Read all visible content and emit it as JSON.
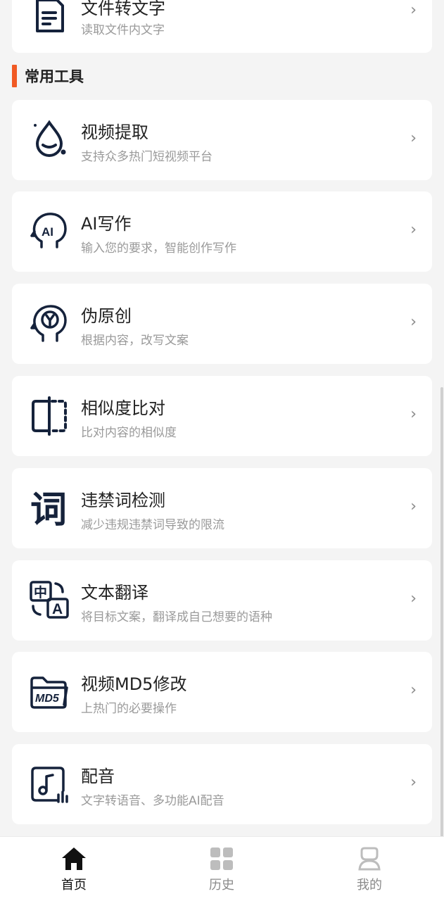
{
  "top_card": {
    "title": "文件转文字",
    "subtitle": "读取文件内文字"
  },
  "section": {
    "title": "常用工具"
  },
  "tools": [
    {
      "title": "视频提取",
      "subtitle": "支持众多热门短视频平台",
      "icon": "video-extract-drop-icon"
    },
    {
      "title": "AI写作",
      "subtitle": "输入您的要求，智能创作写作",
      "icon": "ai-head-icon"
    },
    {
      "title": "伪原创",
      "subtitle": "根据内容，改写文案",
      "icon": "brain-head-icon"
    },
    {
      "title": "相似度比对",
      "subtitle": "比对内容的相似度",
      "icon": "compare-icon"
    },
    {
      "title": "违禁词检测",
      "subtitle": "减少违规违禁词导致的限流",
      "icon": "word-check-icon"
    },
    {
      "title": "文本翻译",
      "subtitle": "将目标文案，翻译成自己想要的语种",
      "icon": "translate-icon"
    },
    {
      "title": "视频MD5修改",
      "subtitle": "上热门的必要操作",
      "icon": "md5-folder-icon"
    },
    {
      "title": "配音",
      "subtitle": "文字转语音、多功能AI配音",
      "icon": "dubbing-icon"
    }
  ],
  "chevron": "›",
  "tabbar": {
    "tabs": [
      {
        "label": "首页",
        "icon": "home-icon",
        "active": true
      },
      {
        "label": "历史",
        "icon": "grid-icon",
        "active": false
      },
      {
        "label": "我的",
        "icon": "user-icon",
        "active": false
      }
    ]
  },
  "colors": {
    "accent": "#f15a24",
    "icon_dark": "#15223b",
    "active_tab": "#111111",
    "inactive_tab": "#b5b5b5"
  }
}
